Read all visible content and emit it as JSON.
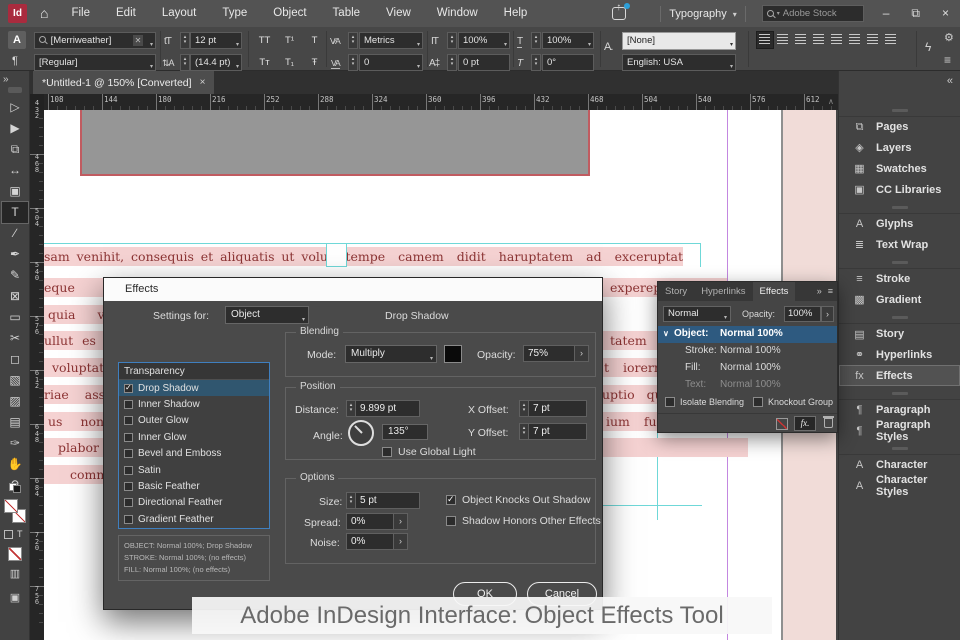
{
  "menubar": {
    "logo_text": "Id",
    "home_icon_glyph": "⌂",
    "menus": [
      {
        "label": "File",
        "name": "menu-file"
      },
      {
        "label": "Edit",
        "name": "menu-edit"
      },
      {
        "label": "Layout",
        "name": "menu-layout"
      },
      {
        "label": "Type",
        "name": "menu-type"
      },
      {
        "label": "Object",
        "name": "menu-object"
      },
      {
        "label": "Table",
        "name": "menu-table"
      },
      {
        "label": "View",
        "name": "menu-view"
      },
      {
        "label": "Window",
        "name": "menu-window"
      },
      {
        "label": "Help",
        "name": "menu-help"
      }
    ],
    "workspace_label": "Typography",
    "search_placeholder": "Adobe Stock",
    "minimize_glyph": "–",
    "restore_glyph": "⧉",
    "close_glyph": "×"
  },
  "controlbar": {
    "char_mode_glyph": "A",
    "para_mode_glyph": "¶",
    "font_family": "[Merriweather]",
    "font_style": "[Regular]",
    "size_icon_glyph": "tT",
    "font_size": "12 pt",
    "leading_icon_glyph": "⇅A",
    "leading": "(14.4 pt)",
    "case_row1": [
      {
        "label": "TT",
        "name": "all-caps-button"
      },
      {
        "label": "T¹",
        "name": "superscript-button"
      },
      {
        "label": "T",
        "name": "underline-button"
      }
    ],
    "case_row2": [
      {
        "label": "Tᴛ",
        "name": "small-caps-button"
      },
      {
        "label": "T₁",
        "name": "subscript-button"
      },
      {
        "label": "Ŧ",
        "name": "strikethrough-button"
      }
    ],
    "kerning_icon_glyph": "V∕A",
    "kerning_value": "Metrics",
    "tracking_icon_glyph": "VA",
    "tracking_value": "0",
    "vscale_icon_glyph": "IT",
    "vscale_value": "100%",
    "baseline_icon_glyph": "A‡",
    "baseline_value": "0 pt",
    "hscale_icon_glyph": "T",
    "hscale_value": "100%",
    "skew_icon_glyph": "T",
    "skew_value": "0°",
    "char_style_icon_glyph": "A.",
    "char_style_value": "[None]",
    "language_value": "English: USA",
    "align_buttons": [
      {
        "name": "align-left-icon",
        "state": "pressed"
      },
      {
        "name": "align-center-icon"
      },
      {
        "name": "align-right-icon"
      },
      {
        "name": "justify-left-icon"
      },
      {
        "name": "justify-center-icon"
      },
      {
        "name": "justify-right-icon"
      },
      {
        "name": "justify-full-icon"
      },
      {
        "name": "justify-all-icon"
      }
    ],
    "sensei_glyph": "ϟ",
    "gear_glyph": "⚙",
    "panel_menu_glyph": "≡"
  },
  "tabbar": {
    "expand_glyph": "»",
    "title": "*Untitled-1 @ 150% [Converted]",
    "close_glyph": "×"
  },
  "rulers": {
    "h_numbers": [
      "108",
      "144",
      "180",
      "216",
      "252",
      "288",
      "324",
      "360",
      "396",
      "432",
      "468",
      "504",
      "540",
      "576",
      "612"
    ],
    "v_numbers": [
      "432",
      "468",
      "504",
      "540",
      "576",
      "612",
      "648",
      "684",
      "720",
      "756"
    ],
    "scroll_up_glyph": "∧"
  },
  "toolbar": {
    "tools": [
      {
        "name": "selection-tool",
        "glyph": "▷"
      },
      {
        "name": "direct-selection-tool",
        "glyph": "▶"
      },
      {
        "name": "page-tool",
        "glyph": "⧉"
      },
      {
        "name": "gap-tool",
        "glyph": "↔"
      },
      {
        "name": "content-collector-tool",
        "glyph": "▣"
      },
      {
        "name": "type-tool",
        "glyph": "T",
        "state": "selected"
      },
      {
        "name": "line-tool",
        "glyph": "∕"
      },
      {
        "name": "pen-tool",
        "glyph": "✒"
      },
      {
        "name": "pencil-tool",
        "glyph": "✎"
      },
      {
        "name": "frame-tool",
        "glyph": "⊠"
      },
      {
        "name": "rectangle-tool",
        "glyph": "▭"
      },
      {
        "name": "scissors-tool",
        "glyph": "✂"
      },
      {
        "name": "free-transform-tool",
        "glyph": "◻"
      },
      {
        "name": "gradient-swatch-tool",
        "glyph": "▧"
      },
      {
        "name": "gradient-feather-tool",
        "glyph": "▨"
      },
      {
        "name": "note-tool",
        "glyph": "▤"
      },
      {
        "name": "eyedropper-tool",
        "glyph": "✑"
      },
      {
        "name": "hand-tool",
        "glyph": "✋"
      },
      {
        "name": "zoom-tool",
        "glyph": "⚲"
      }
    ],
    "fmt_text_glyph": "T",
    "screen_mode_glyph": "▥",
    "preview_glyph": "▣"
  },
  "canvas": {
    "fragments": {
      "l1": "sam venihit, consequis et aliquatis ut volut",
      "l2": "eque exc",
      "l3": "quia vol",
      "l4": "ullut es aut a",
      "l5": "voluptatio.",
      "l6": "riae assunt",
      "l7": "us non pe",
      "l8": "plabor n",
      "l9": "commolu",
      "r1": "atempe camem didit haruptatem ad exceruptat",
      "r2": "experep",
      "r4": "tatem",
      "r5": "t iorerru",
      "r6": "uptio qu",
      "r7": "ium fug",
      "r8": ""
    }
  },
  "effects_dialog": {
    "title": "Effects",
    "settings_for_label": "Settings for:",
    "settings_for_value": "Object",
    "panel_heading": "Drop Shadow",
    "list_header": "Transparency",
    "effects_list": [
      {
        "label": "Drop Shadow",
        "name": "effect-item-drop-shadow",
        "state": "checked selected"
      },
      {
        "label": "Inner Shadow",
        "name": "effect-item-inner-shadow"
      },
      {
        "label": "Outer Glow",
        "name": "effect-item-outer-glow"
      },
      {
        "label": "Inner Glow",
        "name": "effect-item-inner-glow"
      },
      {
        "label": "Bevel and Emboss",
        "name": "effect-item-bevel-emboss"
      },
      {
        "label": "Satin",
        "name": "effect-item-satin"
      },
      {
        "label": "Basic Feather",
        "name": "effect-item-basic-feather"
      },
      {
        "label": "Directional Feather",
        "name": "effect-item-directional-feather"
      },
      {
        "label": "Gradient Feather",
        "name": "effect-item-gradient-feather"
      }
    ],
    "summary_lines": [
      "OBJECT: Normal 100%; Drop Shadow",
      "STROKE: Normal 100%; (no effects)",
      "FILL: Normal 100%; (no effects)"
    ],
    "blending_legend": "Blending",
    "mode_label": "Mode:",
    "mode_value": "Multiply",
    "opacity_label": "Opacity:",
    "opacity_value": "75%",
    "position_legend": "Position",
    "distance_label": "Distance:",
    "distance_value": "9.899 pt",
    "angle_label": "Angle:",
    "angle_value": "135°",
    "use_global_light_label": "Use Global Light",
    "x_offset_label": "X Offset:",
    "x_offset_value": "7 pt",
    "y_offset_label": "Y Offset:",
    "y_offset_value": "7 pt",
    "options_legend": "Options",
    "size_label": "Size:",
    "size_value": "5 pt",
    "spread_label": "Spread:",
    "spread_value": "0%",
    "noise_label": "Noise:",
    "noise_value": "0%",
    "knockout_label": "Object Knocks Out Shadow",
    "honors_label": "Shadow Honors Other Effects",
    "ok_label": "OK",
    "cancel_label": "Cancel",
    "arrow_glyph": "›"
  },
  "effects_panel": {
    "tabs": [
      {
        "label": "Story",
        "name": "tab-story"
      },
      {
        "label": "Hyperlinks",
        "name": "tab-hyperlinks"
      },
      {
        "label": "Effects",
        "name": "tab-effects",
        "state": "active"
      }
    ],
    "expand_glyph": "»",
    "menu_glyph": "≡",
    "tab_updown_glyph": "↕",
    "blend_mode_value": "Normal",
    "opacity_label": "Opacity:",
    "opacity_value": "100%",
    "arrow_glyph": "›",
    "row_chevron_glyph": "∨",
    "rows": [
      {
        "label": "Object:",
        "value": "Normal 100%",
        "name": "effects-row-object",
        "state": "selected"
      },
      {
        "label": "Stroke:",
        "value": "Normal 100%",
        "name": "effects-row-stroke"
      },
      {
        "label": "Fill:",
        "value": "Normal 100%",
        "name": "effects-row-fill"
      },
      {
        "label": "Text:",
        "value": "Normal 100%",
        "name": "effects-row-text",
        "state": "dimmed"
      }
    ],
    "isolate_label": "Isolate Blending",
    "knockout_label": "Knockout Group",
    "fx_label": "fx."
  },
  "sidebar": {
    "collapse_glyph": "«",
    "items": [
      {
        "label": "Pages",
        "name": "sidebar-item-pages",
        "icon": "pages-icon",
        "glyph": "⧉",
        "state": "gstart"
      },
      {
        "label": "Layers",
        "name": "sidebar-item-layers",
        "icon": "layers-icon",
        "glyph": "◈"
      },
      {
        "label": "Swatches",
        "name": "sidebar-item-swatches",
        "icon": "swatches-icon",
        "glyph": "▦"
      },
      {
        "label": "CC Libraries",
        "name": "sidebar-item-cc-libraries",
        "icon": "cc-libraries-icon",
        "glyph": "▣"
      },
      {
        "label": "Glyphs",
        "name": "sidebar-item-glyphs",
        "icon": "glyphs-icon",
        "glyph": "A",
        "state": "gstart"
      },
      {
        "label": "Text Wrap",
        "name": "sidebar-item-text-wrap",
        "icon": "text-wrap-icon",
        "glyph": "≣"
      },
      {
        "label": "Stroke",
        "name": "sidebar-item-stroke",
        "icon": "stroke-icon",
        "glyph": "≡",
        "state": "gstart"
      },
      {
        "label": "Gradient",
        "name": "sidebar-item-gradient",
        "icon": "gradient-icon",
        "glyph": "▩"
      },
      {
        "label": "Story",
        "name": "sidebar-item-story",
        "icon": "story-icon",
        "glyph": "▤",
        "state": "gstart"
      },
      {
        "label": "Hyperlinks",
        "name": "sidebar-item-hyperlinks",
        "icon": "hyperlinks-icon",
        "glyph": "⚭"
      },
      {
        "label": "Effects",
        "name": "sidebar-item-effects",
        "icon": "effects-icon",
        "glyph": "fx",
        "state": "active"
      },
      {
        "label": "Paragraph",
        "name": "sidebar-item-paragraph",
        "icon": "paragraph-icon",
        "glyph": "¶",
        "state": "gstart"
      },
      {
        "label": "Paragraph Styles",
        "name": "sidebar-item-paragraph-styles",
        "icon": "paragraph-styles-icon",
        "glyph": "¶"
      },
      {
        "label": "Character",
        "name": "sidebar-item-character",
        "icon": "character-icon",
        "glyph": "A",
        "state": "gstart"
      },
      {
        "label": "Character Styles",
        "name": "sidebar-item-character-styles",
        "icon": "character-styles-icon",
        "glyph": "A"
      }
    ]
  },
  "caption": {
    "text": "Adobe InDesign Interface: Object Effects Tool"
  },
  "colors": {
    "accent_blue": "#3f7fbf",
    "selected_row_blue": "#2e5a80",
    "highlight_pink": "#f5d2d2",
    "doc_text_red": "#8c3434",
    "guide_cyan": "#6fd8d8",
    "guide_purple": "#c387e0",
    "logo_red": "#a92b3e"
  }
}
